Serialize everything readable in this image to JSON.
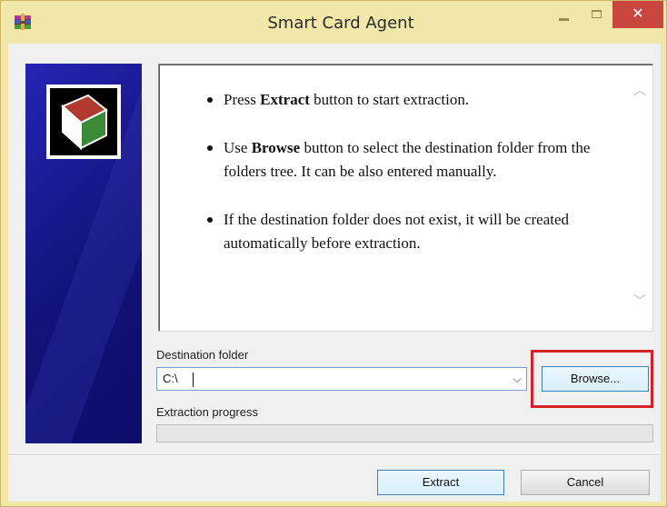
{
  "window": {
    "title": "Smart Card Agent",
    "icon": "winrar-archive-icon",
    "controls": {
      "minimize": "minimize-icon",
      "maximize": "maximize-icon",
      "close": "close-icon",
      "close_glyph": "✕"
    }
  },
  "sidebar": {
    "logo": "smart-card-logo"
  },
  "instructions": {
    "items": [
      {
        "pre": "Press ",
        "bold": "Extract",
        "post": " button to start extraction."
      },
      {
        "pre": "Use ",
        "bold": "Browse",
        "post": " button to select the destination folder from the folders tree. It can be also entered manually."
      },
      {
        "pre": "",
        "bold": "",
        "post": "If the destination folder does not exist, it will be created automatically before extraction."
      }
    ],
    "scroll_up": "chevron-up-icon",
    "scroll_down": "chevron-down-icon"
  },
  "destination": {
    "label": "Destination folder",
    "value": "C:\\",
    "dropdown_icon": "chevron-down-icon"
  },
  "browse_button": "Browse...",
  "progress": {
    "label": "Extraction progress",
    "fraction": 0
  },
  "buttons": {
    "extract": "Extract",
    "cancel": "Cancel"
  },
  "colors": {
    "titlebar": "#f1e7a9",
    "close_button": "#c8463d",
    "sidebar": "#1a1a8a",
    "highlight": "#d4202a",
    "progress_fill": "#06b025"
  }
}
